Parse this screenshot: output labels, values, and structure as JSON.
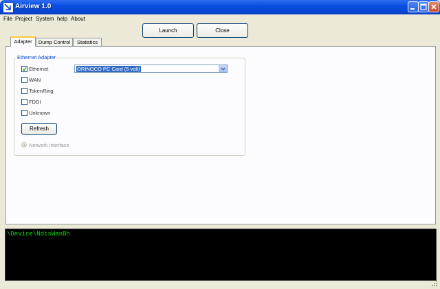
{
  "window": {
    "title": "Airview 1.0"
  },
  "menu": [
    "File",
    "Project",
    "System",
    "help",
    "About"
  ],
  "toolbar": {
    "launch_label": "Launch",
    "close_label": "Close"
  },
  "tabs": [
    {
      "label": "Adapter",
      "active": true
    },
    {
      "label": "Dump Control",
      "active": false
    },
    {
      "label": "Statistics",
      "active": false
    }
  ],
  "adapter": {
    "group_title": "Ethernet Adapter",
    "checkboxes": [
      {
        "label": "Ethernet",
        "checked": true
      },
      {
        "label": "WAN",
        "checked": false
      },
      {
        "label": "TokenRing",
        "checked": false
      },
      {
        "label": "FDDI",
        "checked": false
      },
      {
        "label": "Unknown",
        "checked": false
      }
    ],
    "select_value": "ORINOCO PC Card (5 volt)",
    "refresh_label": "Refresh",
    "radio_label": "Network Interface"
  },
  "console": {
    "text": "\\Device\\NdisWanBh"
  },
  "colors": {
    "titlebar": "#0a4fe0",
    "console_bg": "#000000",
    "console_text": "#00e000",
    "selection": "#316ac5"
  }
}
